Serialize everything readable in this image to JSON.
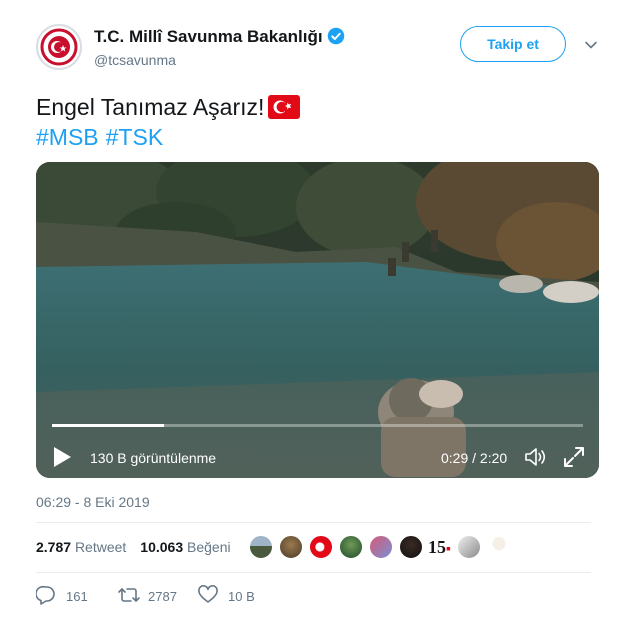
{
  "account": {
    "name": "T.C. Millî Savunma Bakanlığı",
    "handle": "@tcsavunma",
    "follow_label": "Takip et"
  },
  "tweet": {
    "text": "Engel Tanımaz Aşarız!",
    "hashtags": [
      "#MSB",
      "#TSK"
    ]
  },
  "video": {
    "views": "130 B görüntülenme",
    "time": "0:29 / 2:20",
    "progress": 0.21
  },
  "timestamp": "06:29 - 8 Eki 2019",
  "stats": {
    "retweet_count": "2.787",
    "retweet_label": "Retweet",
    "like_count": "10.063",
    "like_label": "Beğeni",
    "liker_badge": "15"
  },
  "actions": {
    "reply_count": "161",
    "retweet_count": "2787",
    "like_count": "10 B"
  },
  "colors": {
    "accent": "#1da1f2",
    "flag_red": "#e30a17"
  }
}
